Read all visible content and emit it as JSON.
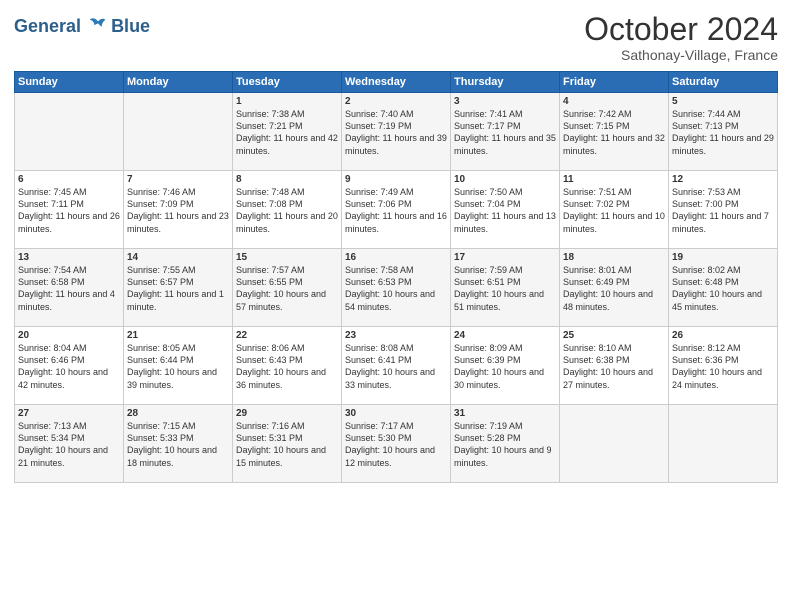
{
  "header": {
    "logo_line1": "General",
    "logo_line2": "Blue",
    "month": "October 2024",
    "location": "Sathonay-Village, France"
  },
  "days_of_week": [
    "Sunday",
    "Monday",
    "Tuesday",
    "Wednesday",
    "Thursday",
    "Friday",
    "Saturday"
  ],
  "weeks": [
    [
      {
        "day": "",
        "sunrise": "",
        "sunset": "",
        "daylight": ""
      },
      {
        "day": "",
        "sunrise": "",
        "sunset": "",
        "daylight": ""
      },
      {
        "day": "1",
        "sunrise": "Sunrise: 7:38 AM",
        "sunset": "Sunset: 7:21 PM",
        "daylight": "Daylight: 11 hours and 42 minutes."
      },
      {
        "day": "2",
        "sunrise": "Sunrise: 7:40 AM",
        "sunset": "Sunset: 7:19 PM",
        "daylight": "Daylight: 11 hours and 39 minutes."
      },
      {
        "day": "3",
        "sunrise": "Sunrise: 7:41 AM",
        "sunset": "Sunset: 7:17 PM",
        "daylight": "Daylight: 11 hours and 35 minutes."
      },
      {
        "day": "4",
        "sunrise": "Sunrise: 7:42 AM",
        "sunset": "Sunset: 7:15 PM",
        "daylight": "Daylight: 11 hours and 32 minutes."
      },
      {
        "day": "5",
        "sunrise": "Sunrise: 7:44 AM",
        "sunset": "Sunset: 7:13 PM",
        "daylight": "Daylight: 11 hours and 29 minutes."
      }
    ],
    [
      {
        "day": "6",
        "sunrise": "Sunrise: 7:45 AM",
        "sunset": "Sunset: 7:11 PM",
        "daylight": "Daylight: 11 hours and 26 minutes."
      },
      {
        "day": "7",
        "sunrise": "Sunrise: 7:46 AM",
        "sunset": "Sunset: 7:09 PM",
        "daylight": "Daylight: 11 hours and 23 minutes."
      },
      {
        "day": "8",
        "sunrise": "Sunrise: 7:48 AM",
        "sunset": "Sunset: 7:08 PM",
        "daylight": "Daylight: 11 hours and 20 minutes."
      },
      {
        "day": "9",
        "sunrise": "Sunrise: 7:49 AM",
        "sunset": "Sunset: 7:06 PM",
        "daylight": "Daylight: 11 hours and 16 minutes."
      },
      {
        "day": "10",
        "sunrise": "Sunrise: 7:50 AM",
        "sunset": "Sunset: 7:04 PM",
        "daylight": "Daylight: 11 hours and 13 minutes."
      },
      {
        "day": "11",
        "sunrise": "Sunrise: 7:51 AM",
        "sunset": "Sunset: 7:02 PM",
        "daylight": "Daylight: 11 hours and 10 minutes."
      },
      {
        "day": "12",
        "sunrise": "Sunrise: 7:53 AM",
        "sunset": "Sunset: 7:00 PM",
        "daylight": "Daylight: 11 hours and 7 minutes."
      }
    ],
    [
      {
        "day": "13",
        "sunrise": "Sunrise: 7:54 AM",
        "sunset": "Sunset: 6:58 PM",
        "daylight": "Daylight: 11 hours and 4 minutes."
      },
      {
        "day": "14",
        "sunrise": "Sunrise: 7:55 AM",
        "sunset": "Sunset: 6:57 PM",
        "daylight": "Daylight: 11 hours and 1 minute."
      },
      {
        "day": "15",
        "sunrise": "Sunrise: 7:57 AM",
        "sunset": "Sunset: 6:55 PM",
        "daylight": "Daylight: 10 hours and 57 minutes."
      },
      {
        "day": "16",
        "sunrise": "Sunrise: 7:58 AM",
        "sunset": "Sunset: 6:53 PM",
        "daylight": "Daylight: 10 hours and 54 minutes."
      },
      {
        "day": "17",
        "sunrise": "Sunrise: 7:59 AM",
        "sunset": "Sunset: 6:51 PM",
        "daylight": "Daylight: 10 hours and 51 minutes."
      },
      {
        "day": "18",
        "sunrise": "Sunrise: 8:01 AM",
        "sunset": "Sunset: 6:49 PM",
        "daylight": "Daylight: 10 hours and 48 minutes."
      },
      {
        "day": "19",
        "sunrise": "Sunrise: 8:02 AM",
        "sunset": "Sunset: 6:48 PM",
        "daylight": "Daylight: 10 hours and 45 minutes."
      }
    ],
    [
      {
        "day": "20",
        "sunrise": "Sunrise: 8:04 AM",
        "sunset": "Sunset: 6:46 PM",
        "daylight": "Daylight: 10 hours and 42 minutes."
      },
      {
        "day": "21",
        "sunrise": "Sunrise: 8:05 AM",
        "sunset": "Sunset: 6:44 PM",
        "daylight": "Daylight: 10 hours and 39 minutes."
      },
      {
        "day": "22",
        "sunrise": "Sunrise: 8:06 AM",
        "sunset": "Sunset: 6:43 PM",
        "daylight": "Daylight: 10 hours and 36 minutes."
      },
      {
        "day": "23",
        "sunrise": "Sunrise: 8:08 AM",
        "sunset": "Sunset: 6:41 PM",
        "daylight": "Daylight: 10 hours and 33 minutes."
      },
      {
        "day": "24",
        "sunrise": "Sunrise: 8:09 AM",
        "sunset": "Sunset: 6:39 PM",
        "daylight": "Daylight: 10 hours and 30 minutes."
      },
      {
        "day": "25",
        "sunrise": "Sunrise: 8:10 AM",
        "sunset": "Sunset: 6:38 PM",
        "daylight": "Daylight: 10 hours and 27 minutes."
      },
      {
        "day": "26",
        "sunrise": "Sunrise: 8:12 AM",
        "sunset": "Sunset: 6:36 PM",
        "daylight": "Daylight: 10 hours and 24 minutes."
      }
    ],
    [
      {
        "day": "27",
        "sunrise": "Sunrise: 7:13 AM",
        "sunset": "Sunset: 5:34 PM",
        "daylight": "Daylight: 10 hours and 21 minutes."
      },
      {
        "day": "28",
        "sunrise": "Sunrise: 7:15 AM",
        "sunset": "Sunset: 5:33 PM",
        "daylight": "Daylight: 10 hours and 18 minutes."
      },
      {
        "day": "29",
        "sunrise": "Sunrise: 7:16 AM",
        "sunset": "Sunset: 5:31 PM",
        "daylight": "Daylight: 10 hours and 15 minutes."
      },
      {
        "day": "30",
        "sunrise": "Sunrise: 7:17 AM",
        "sunset": "Sunset: 5:30 PM",
        "daylight": "Daylight: 10 hours and 12 minutes."
      },
      {
        "day": "31",
        "sunrise": "Sunrise: 7:19 AM",
        "sunset": "Sunset: 5:28 PM",
        "daylight": "Daylight: 10 hours and 9 minutes."
      },
      {
        "day": "",
        "sunrise": "",
        "sunset": "",
        "daylight": ""
      },
      {
        "day": "",
        "sunrise": "",
        "sunset": "",
        "daylight": ""
      }
    ]
  ]
}
